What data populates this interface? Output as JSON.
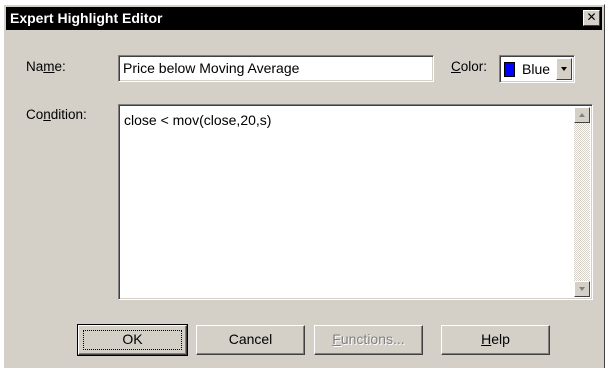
{
  "window": {
    "title": "Expert Highlight Editor",
    "close_glyph": "✕"
  },
  "name_field": {
    "label_pre": "Na",
    "label_accel": "m",
    "label_post": "e:",
    "value": "Price below Moving Average"
  },
  "color_field": {
    "label_accel": "C",
    "label_post": "olor:",
    "value": "Blue",
    "swatch_color": "#0000ff"
  },
  "condition_field": {
    "label_pre": "Co",
    "label_accel": "n",
    "label_post": "dition:",
    "value": "close < mov(close,20,s)"
  },
  "buttons": {
    "ok": "OK",
    "cancel": "Cancel",
    "functions_accel": "F",
    "functions_rest": "unctions...",
    "help_accel": "H",
    "help_rest": "elp"
  },
  "icons": {
    "close": "close-icon",
    "dropdown": "chevron-down-icon",
    "scroll_up": "scroll-up-arrow-icon",
    "scroll_down": "scroll-down-arrow-icon"
  }
}
